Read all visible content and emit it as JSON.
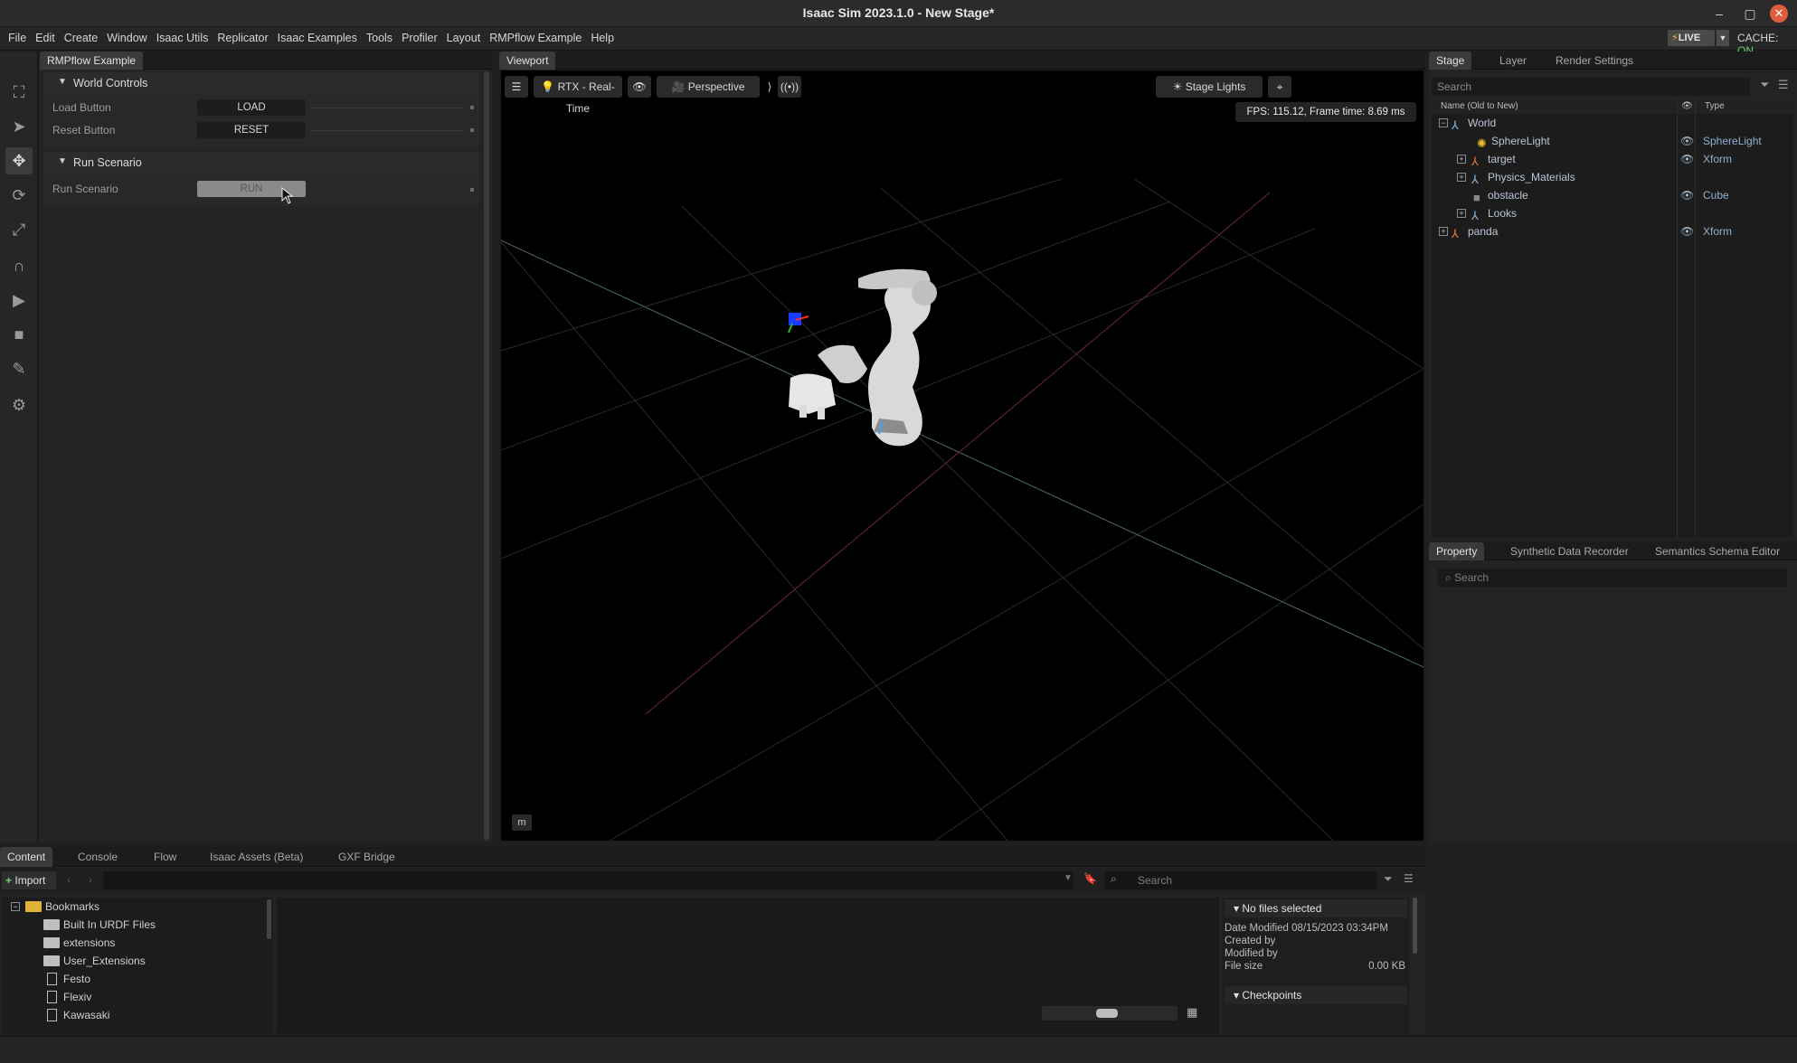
{
  "window": {
    "title": "Isaac Sim 2023.1.0 - New Stage*",
    "minimize_icon": "minimize-icon",
    "maximize_icon": "maximize-icon",
    "close_icon": "close-icon"
  },
  "menu": {
    "items": [
      "File",
      "Edit",
      "Create",
      "Window",
      "Isaac Utils",
      "Replicator",
      "Isaac Examples",
      "Tools",
      "Profiler",
      "Layout",
      "RMPflow Example",
      "Help"
    ],
    "live_label": "LIVE",
    "cache_label": "CACHE:",
    "cache_state": "ON"
  },
  "toolbar": {
    "tools": [
      "select-mode-icon",
      "select-icon",
      "move-icon",
      "rotate-icon",
      "scale-icon",
      "snap-icon",
      "play-icon",
      "stop-icon",
      "paint-icon",
      "sim-icon"
    ]
  },
  "rmpflow": {
    "tab": "RMPflow Example",
    "world_controls": {
      "header": "World Controls",
      "load_label": "Load Button",
      "load_button": "LOAD",
      "reset_label": "Reset Button",
      "reset_button": "RESET"
    },
    "run_scenario": {
      "header": "Run Scenario",
      "label": "Run Scenario",
      "button": "RUN"
    }
  },
  "viewport": {
    "tab": "Viewport",
    "renderer": "RTX - Real-Time",
    "camera": "Perspective",
    "lights": "Stage Lights",
    "fps_text": "FPS: 115.12, Frame time: 8.69 ms",
    "unit": "m"
  },
  "stage": {
    "tabs": [
      "Stage",
      "Layer",
      "Render Settings"
    ],
    "search_placeholder": "Search",
    "col_name": "Name (Old to New)",
    "col_type": "Type",
    "prims": [
      {
        "name": "World",
        "type": ""
      },
      {
        "name": "SphereLight",
        "type": "SphereLight"
      },
      {
        "name": "target",
        "type": "Xform"
      },
      {
        "name": "Physics_Materials",
        "type": ""
      },
      {
        "name": "obstacle",
        "type": "Cube"
      },
      {
        "name": "Looks",
        "type": ""
      },
      {
        "name": "panda",
        "type": "Xform"
      }
    ]
  },
  "property": {
    "tabs": [
      "Property",
      "Synthetic Data Recorder",
      "Semantics Schema Editor"
    ],
    "search_placeholder": "Search"
  },
  "content": {
    "tabs": [
      "Content",
      "Console",
      "Flow",
      "Isaac Assets (Beta)",
      "GXF Bridge"
    ],
    "import_label": "Import",
    "search_placeholder": "Search",
    "bookmarks": [
      "Bookmarks",
      "Built In URDF Files",
      "extensions",
      "User_Extensions",
      "Festo",
      "Flexiv",
      "Kawasaki"
    ],
    "details": {
      "header": "No files selected",
      "date_modified": "Date Modified 08/15/2023 03:34PM",
      "created_by": "Created by",
      "modified_by": "Modified by",
      "file_size_label": "File size",
      "file_size_value": "0.00 KB",
      "checkpoints": "Checkpoints"
    }
  },
  "colors": {
    "accent_green": "#6dd36d",
    "live_bolt": "#f0c030",
    "close_button": "#e05a3d"
  }
}
